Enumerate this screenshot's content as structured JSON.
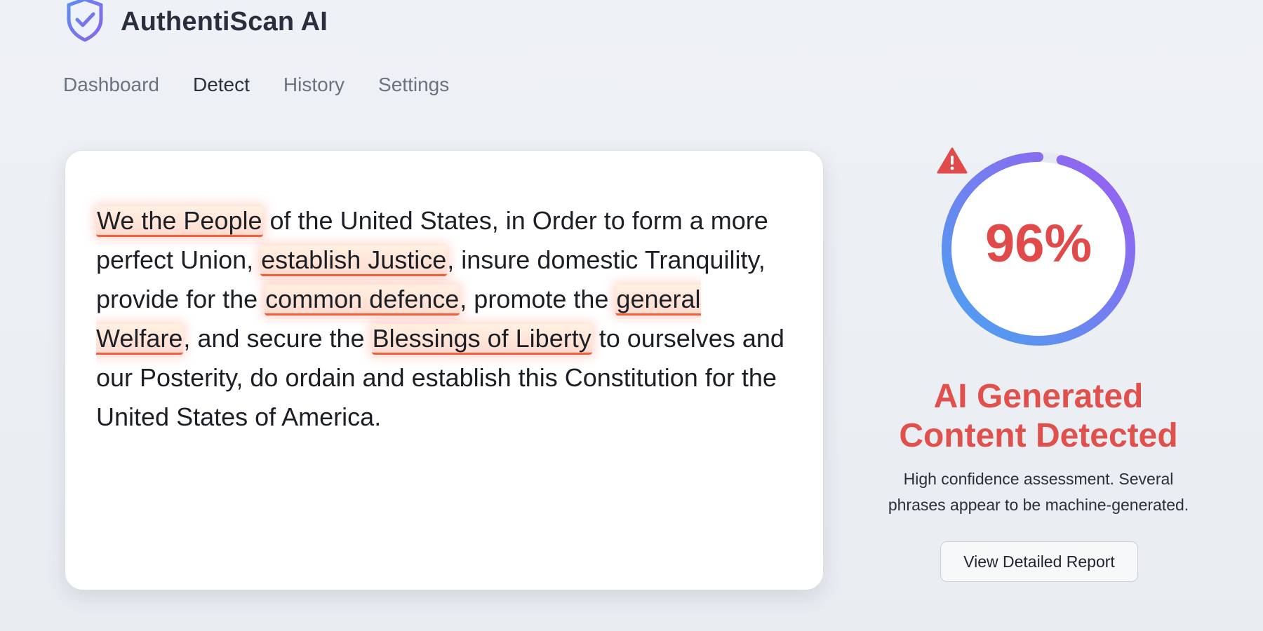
{
  "app": {
    "name": "AuthentiScan AI",
    "logo_icon": "shield-check-icon"
  },
  "nav": {
    "items": [
      {
        "label": "Dashboard",
        "active": false
      },
      {
        "label": "Detect",
        "active": true
      },
      {
        "label": "History",
        "active": false
      },
      {
        "label": "Settings",
        "active": false
      }
    ]
  },
  "analyzed_text": {
    "segments": [
      {
        "text": "We the People",
        "flagged": true
      },
      {
        "text": " of the United States, in Order to form a more perfect Union, ",
        "flagged": false
      },
      {
        "text": "establish Justice",
        "flagged": true
      },
      {
        "text": ", insure domestic Tranquility, provide for the ",
        "flagged": false
      },
      {
        "text": "common defence",
        "flagged": true
      },
      {
        "text": ", promote the ",
        "flagged": false
      },
      {
        "text": "general Welfare",
        "flagged": true
      },
      {
        "text": ", and secure the ",
        "flagged": false
      },
      {
        "text": "Blessings of Liberty",
        "flagged": true
      },
      {
        "text": " to ourselves and our Posterity, do ordain and establish this Constitution for the United States of America.",
        "flagged": false
      }
    ]
  },
  "result": {
    "score_label": "96%",
    "score_value": 96,
    "warning_icon": "warning-triangle-icon",
    "verdict_line1": "AI Generated",
    "verdict_line2": "Content Detected",
    "description_line1": "High confidence assessment. Several",
    "description_line2": "phrases appear to be machine-generated.",
    "report_button": "View Detailed Report"
  },
  "colors": {
    "accent_red": "#e04a4a",
    "gauge_start": "#4aa3f0",
    "gauge_end": "#9b5cf0",
    "highlight_underline": "#f0603a"
  }
}
